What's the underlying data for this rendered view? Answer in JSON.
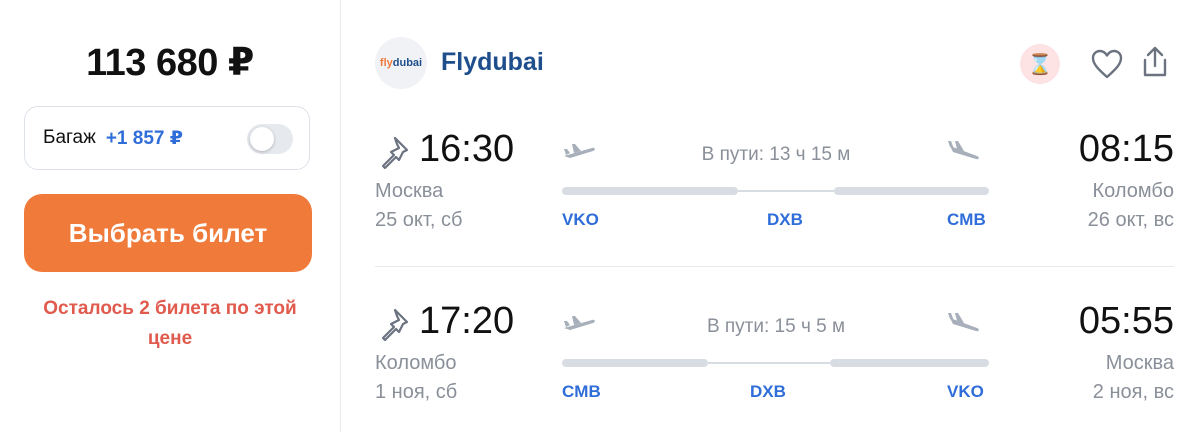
{
  "offer": {
    "price": "113 680 ₽",
    "baggage_label": "Багаж",
    "baggage_price": "+1 857 ₽",
    "baggage_toggle": "off",
    "buy_label": "Выбрать билет",
    "warning": "Осталось 2 билета по этой цене"
  },
  "airline": {
    "logo_text_fly": "fly",
    "logo_text_dubai": "dubai",
    "name": "Flydubai"
  },
  "legs": [
    {
      "dep_time": "16:30",
      "dep_city": "Москва",
      "dep_date": "25 окт, сб",
      "arr_time": "08:15",
      "arr_city": "Коломбо",
      "arr_date": "26 окт, вс",
      "duration": "В пути: 13 ч 15 м",
      "codes": [
        "VKO",
        "DXB",
        "CMB"
      ]
    },
    {
      "dep_time": "17:20",
      "dep_city": "Коломбо",
      "dep_date": "1 ноя, сб",
      "arr_time": "05:55",
      "arr_city": "Москва",
      "arr_date": "2 ноя, вс",
      "duration": "В пути: 15 ч 5 м",
      "codes": [
        "CMB",
        "DXB",
        "VKO"
      ]
    }
  ],
  "icons": [
    "hourglass-icon",
    "heart-icon",
    "share-icon",
    "pin-icon",
    "plane-takeoff-icon",
    "plane-landing-icon"
  ],
  "colors": {
    "accent": "#f07a3a",
    "link": "#2f6dd9",
    "warning": "#e05a4e",
    "airline": "#1f4e8c"
  }
}
